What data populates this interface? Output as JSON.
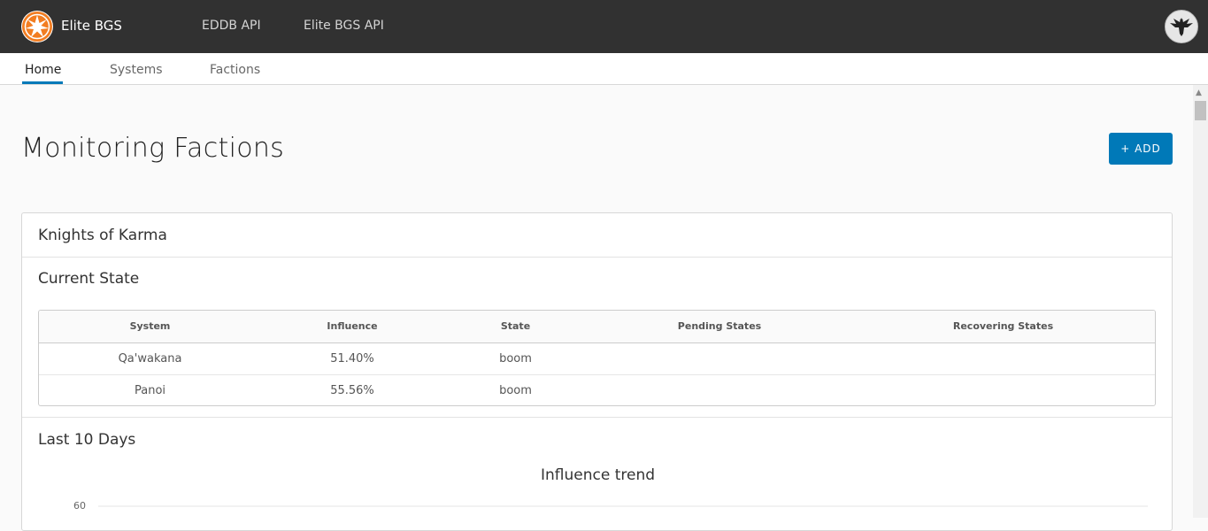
{
  "header": {
    "brand": "Elite BGS",
    "nav": [
      "EDDB API",
      "Elite BGS API"
    ]
  },
  "subnav": {
    "tabs": [
      "Home",
      "Systems",
      "Factions"
    ],
    "active": "Home"
  },
  "main": {
    "title": "Monitoring Factions",
    "add_label": "+ ADD"
  },
  "faction_card": {
    "name": "Knights of Karma",
    "current_state_title": "Current State",
    "table": {
      "columns": [
        "System",
        "Influence",
        "State",
        "Pending States",
        "Recovering States"
      ],
      "rows": [
        [
          "Qa'wakana",
          "51.40%",
          "boom",
          "",
          ""
        ],
        [
          "Panoi",
          "55.56%",
          "boom",
          "",
          ""
        ]
      ]
    },
    "history_title": "Last 10 Days"
  },
  "chart_data": {
    "type": "line",
    "title": "Influence trend",
    "y_ticks_visible": [
      "60"
    ],
    "series": []
  },
  "colors": {
    "header_bg": "#313131",
    "accent": "#0079b8",
    "logo_orange": "#f27d21"
  },
  "icons": {
    "logo": "star-icon",
    "avatar": "eagle-icon"
  }
}
